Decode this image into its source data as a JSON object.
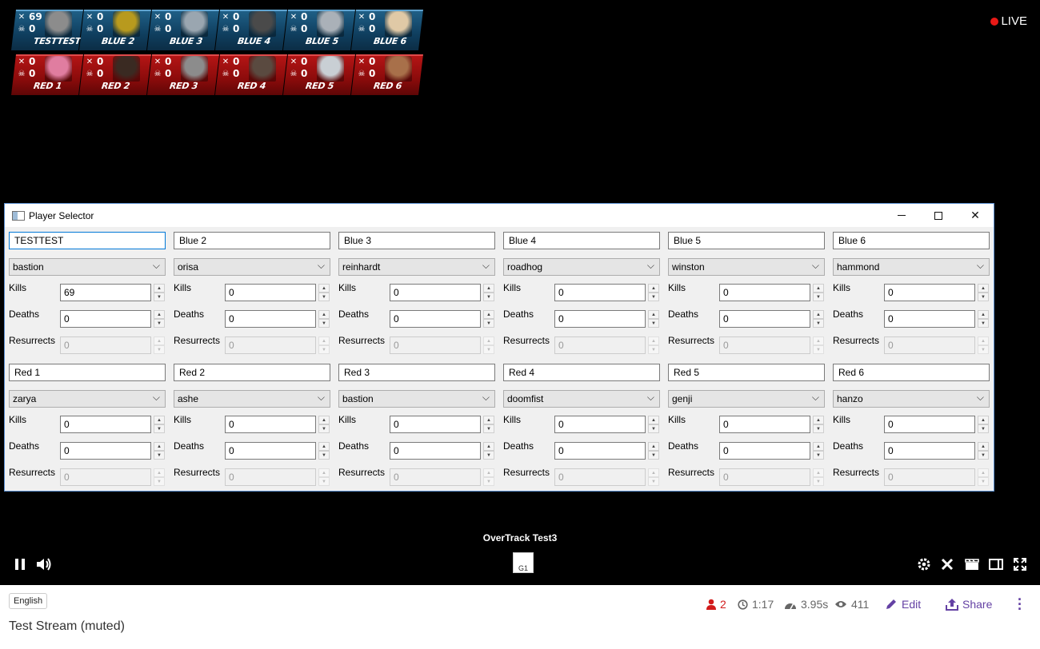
{
  "live_label": "LIVE",
  "scoreboard": {
    "blue": [
      {
        "kills": "69",
        "deaths": "0",
        "name": "TESTTEST",
        "portrait": "#8c8c8c"
      },
      {
        "kills": "0",
        "deaths": "0",
        "name": "BLUE 2",
        "portrait": "#b89a1e"
      },
      {
        "kills": "0",
        "deaths": "0",
        "name": "BLUE 3",
        "portrait": "#9aa6b0"
      },
      {
        "kills": "0",
        "deaths": "0",
        "name": "BLUE 4",
        "portrait": "#4a4a4a"
      },
      {
        "kills": "0",
        "deaths": "0",
        "name": "BLUE 5",
        "portrait": "#aab1b8"
      },
      {
        "kills": "0",
        "deaths": "0",
        "name": "BLUE 6",
        "portrait": "#e0c9a6"
      }
    ],
    "red": [
      {
        "kills": "0",
        "deaths": "0",
        "name": "RED 1",
        "portrait": "#e07da0"
      },
      {
        "kills": "0",
        "deaths": "0",
        "name": "RED 2",
        "portrait": "#3a2a22"
      },
      {
        "kills": "0",
        "deaths": "0",
        "name": "RED 3",
        "portrait": "#8c8c8c"
      },
      {
        "kills": "0",
        "deaths": "0",
        "name": "RED 4",
        "portrait": "#5a4a40"
      },
      {
        "kills": "0",
        "deaths": "0",
        "name": "RED 5",
        "portrait": "#c9cfd4"
      },
      {
        "kills": "0",
        "deaths": "0",
        "name": "RED 6",
        "portrait": "#a8704a"
      }
    ]
  },
  "window": {
    "title": "Player Selector",
    "labels": {
      "kills": "Kills",
      "deaths": "Deaths",
      "resurrects": "Resurrects"
    },
    "blue": [
      {
        "name": "TESTTEST",
        "hero": "bastion",
        "kills": "69",
        "deaths": "0",
        "resurrects": "0"
      },
      {
        "name": "Blue 2",
        "hero": "orisa",
        "kills": "0",
        "deaths": "0",
        "resurrects": "0"
      },
      {
        "name": "Blue 3",
        "hero": "reinhardt",
        "kills": "0",
        "deaths": "0",
        "resurrects": "0"
      },
      {
        "name": "Blue 4",
        "hero": "roadhog",
        "kills": "0",
        "deaths": "0",
        "resurrects": "0"
      },
      {
        "name": "Blue 5",
        "hero": "winston",
        "kills": "0",
        "deaths": "0",
        "resurrects": "0"
      },
      {
        "name": "Blue 6",
        "hero": "hammond",
        "kills": "0",
        "deaths": "0",
        "resurrects": "0"
      }
    ],
    "red": [
      {
        "name": "Red 1",
        "hero": "zarya",
        "kills": "0",
        "deaths": "0",
        "resurrects": "0"
      },
      {
        "name": "Red 2",
        "hero": "ashe",
        "kills": "0",
        "deaths": "0",
        "resurrects": "0"
      },
      {
        "name": "Red 3",
        "hero": "bastion",
        "kills": "0",
        "deaths": "0",
        "resurrects": "0"
      },
      {
        "name": "Red 4",
        "hero": "doomfist",
        "kills": "0",
        "deaths": "0",
        "resurrects": "0"
      },
      {
        "name": "Red 5",
        "hero": "genji",
        "kills": "0",
        "deaths": "0",
        "resurrects": "0"
      },
      {
        "name": "Red 6",
        "hero": "hanzo",
        "kills": "0",
        "deaths": "0",
        "resurrects": "0"
      }
    ]
  },
  "player": {
    "stream_title": "OverTrack Test3",
    "center_icon_alt": "G1"
  },
  "info": {
    "language": "English",
    "stream_name": "Test Stream (muted)",
    "viewers": "2",
    "uptime": "1:17",
    "latency": "3.95s",
    "views": "411",
    "edit_label": "Edit",
    "share_label": "Share"
  },
  "colors": {
    "blue_team": "#1f5f86",
    "red_team": "#b41515",
    "live": "#e91916",
    "accent": "#6441a4"
  }
}
